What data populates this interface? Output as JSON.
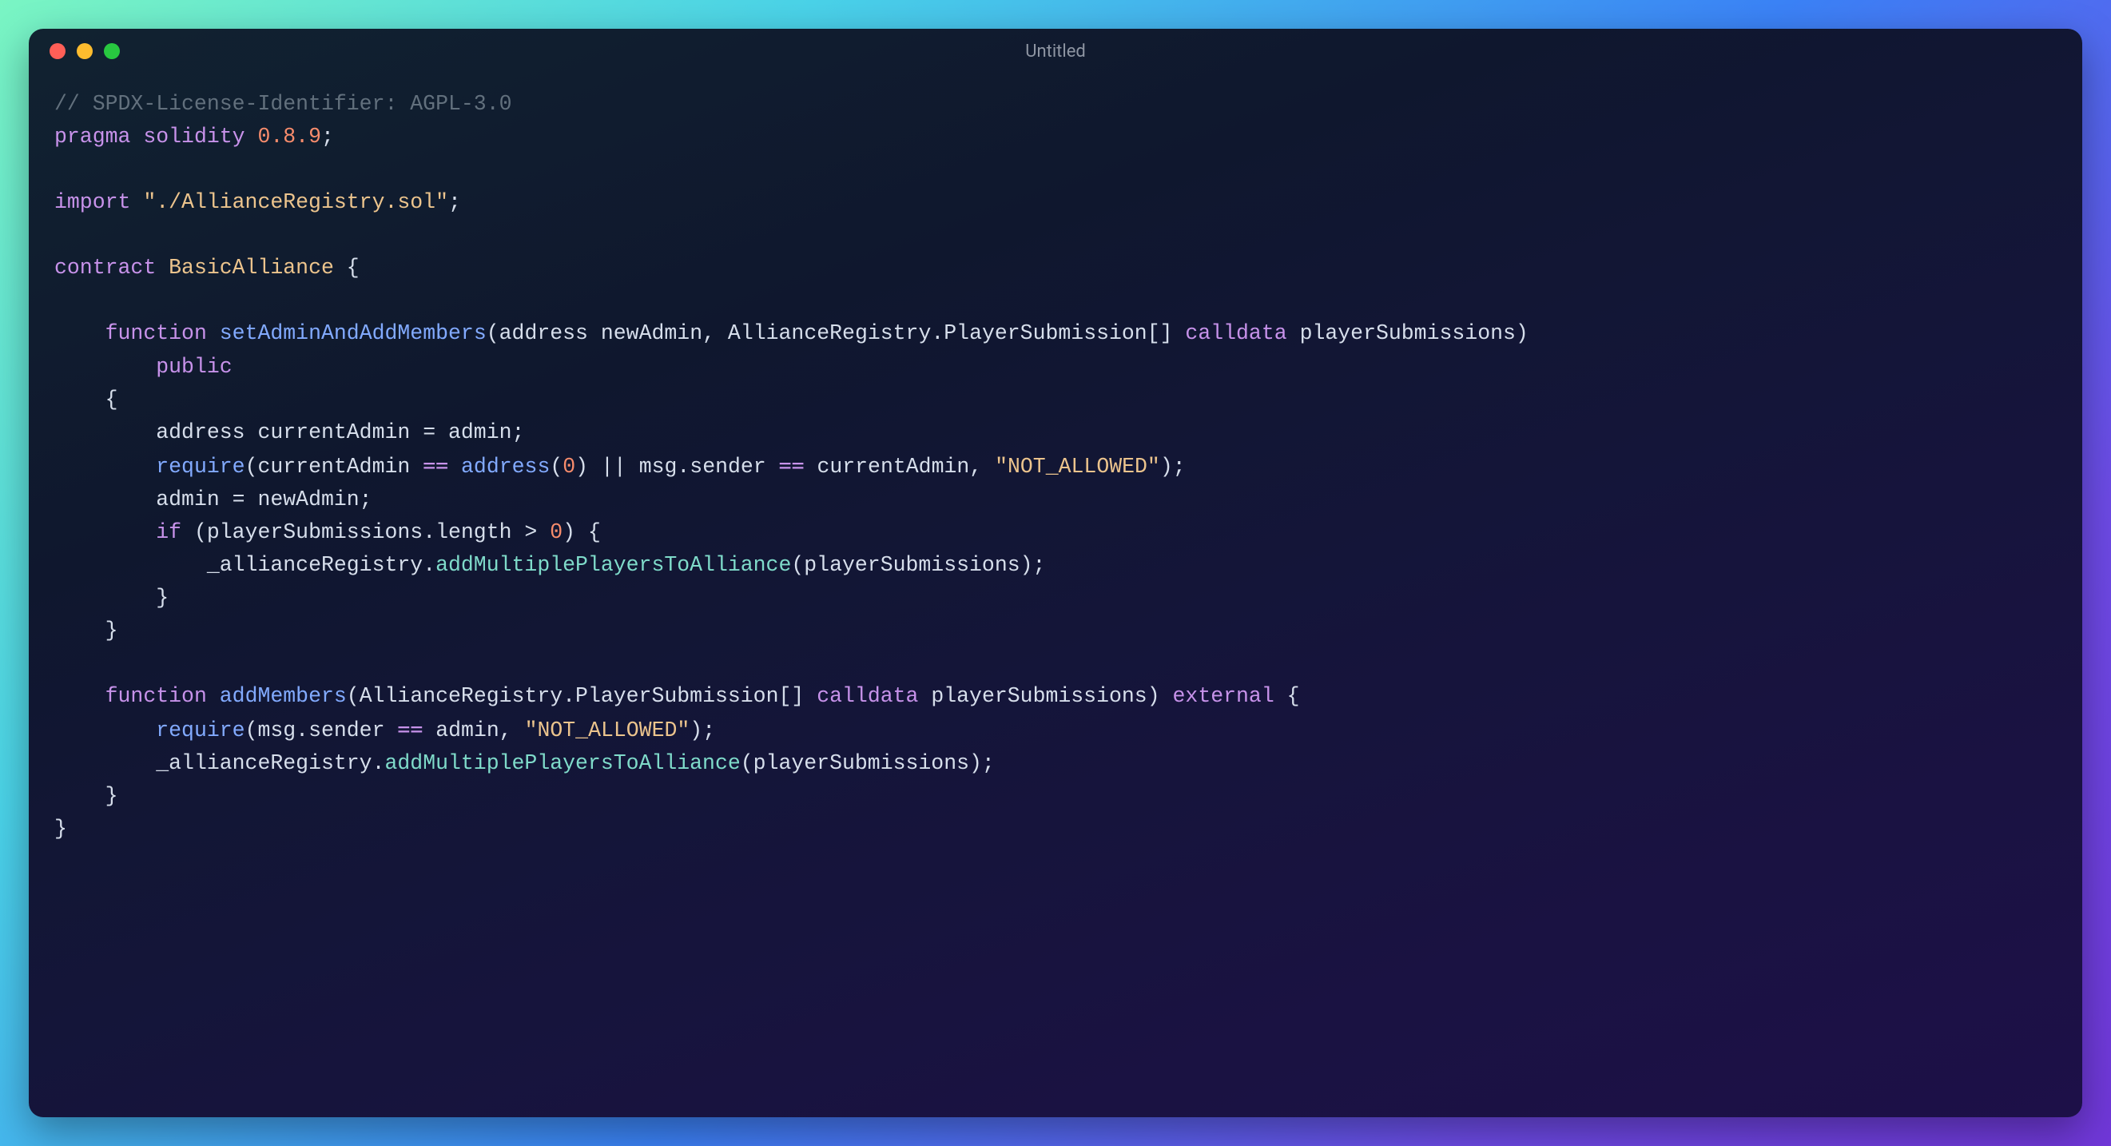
{
  "window": {
    "title": "Untitled"
  },
  "code": {
    "license_comment": "// SPDX-License-Identifier: AGPL-3.0",
    "pragma_kw": "pragma",
    "solidity_kw": "solidity",
    "version": "0.8.9",
    "import_kw": "import",
    "import_path": "\"./AllianceRegistry.sol\"",
    "contract_kw": "contract",
    "contract_name": "BasicAlliance",
    "fn_kw": "function",
    "fn1_name": "setAdminAndAddMembers",
    "addr_type": "address",
    "param_newAdmin": "newAdmin",
    "ar_type": "AllianceRegistry.PlayerSubmission[]",
    "calldata_kw": "calldata",
    "param_ps": "playerSubmissions",
    "public_kw": "public",
    "local_decl": "address currentAdmin = admin;",
    "require_kw": "require",
    "cond1_a": "(currentAdmin ",
    "eq1": "==",
    "address_fn": "address",
    "zero": "0",
    "cond1_b": " || msg.sender ",
    "eq2": "==",
    "cond1_c": " currentAdmin, ",
    "not_allowed": "\"NOT_ALLOWED\"",
    "assign_admin": "admin = newAdmin;",
    "if_kw": "if",
    "if_cond_a": " (playerSubmissions.length > ",
    "if_cond_b": ") {",
    "ar_var": "_allianceRegistry.",
    "ar_method": "addMultiplePlayersToAlliance",
    "call_args": "(playerSubmissions);",
    "fn2_name": "addMembers",
    "external_kw": "external",
    "cond2_a": "(msg.sender ",
    "eq3": "==",
    "cond2_b": " admin, "
  }
}
